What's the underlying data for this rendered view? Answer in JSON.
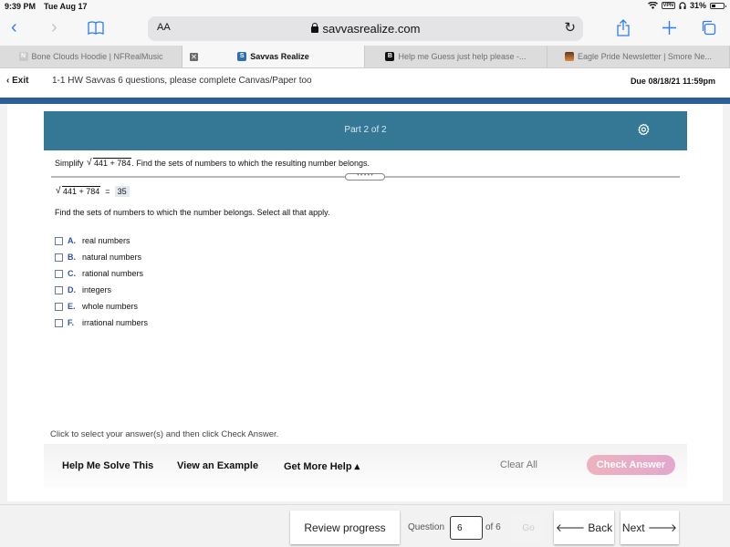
{
  "status_bar": {
    "time": "9:39 PM",
    "date": "Tue Aug 17",
    "vpn_label": "VPN",
    "battery_percent": "31%",
    "battery_level": 0.31
  },
  "browser": {
    "text_size_label": "AA",
    "url": "savvasrealize.com",
    "icons": [
      "back-icon",
      "forward-icon",
      "bookmarks-icon",
      "lock-icon",
      "reload-icon",
      "share-icon",
      "new-tab-icon",
      "tabs-icon"
    ]
  },
  "tabs": [
    {
      "title": "Bone Clouds Hoodie | NFRealMusic",
      "favicon": "N",
      "active": false
    },
    {
      "title": "Savvas Realize",
      "favicon": "S",
      "active": true
    },
    {
      "title": "Help me Guess just help please -...",
      "favicon": "B",
      "active": false
    },
    {
      "title": "Eagle Pride Newsletter | Smore Ne...",
      "favicon": "",
      "active": false
    }
  ],
  "assignment": {
    "exit_label": "Exit",
    "title": "1-1 HW Savvas 6 questions, please complete Canvas/Paper too",
    "due": "Due 08/18/21 11:59pm"
  },
  "question": {
    "part_label": "Part 2 of 2",
    "prompt_prefix": "Simplify",
    "radicand": "441 + 784",
    "prompt_suffix": ". Find the sets of numbers to which the resulting number belongs.",
    "grip_dots": "• • • • •",
    "answer_radicand": "441 + 784",
    "equals": "=",
    "answer_value": "35",
    "instruction": "Find the sets of numbers to which the number belongs. Select all that apply.",
    "options": [
      {
        "letter": "A.",
        "text": "real numbers",
        "checked": false
      },
      {
        "letter": "B.",
        "text": "natural numbers",
        "checked": false
      },
      {
        "letter": "C.",
        "text": "rational numbers",
        "checked": false
      },
      {
        "letter": "D.",
        "text": "integers",
        "checked": false
      },
      {
        "letter": "E.",
        "text": "whole numbers",
        "checked": false
      },
      {
        "letter": "F.",
        "text": "irrational numbers",
        "checked": false
      }
    ]
  },
  "help": {
    "hint": "Click to select your answer(s) and then click Check Answer.",
    "help_me_solve": "Help Me Solve This",
    "view_example": "View an Example",
    "get_more_help": "Get More Help ▴",
    "clear_all": "Clear All",
    "check_answer": "Check Answer"
  },
  "footer": {
    "review_progress": "Review progress",
    "question_label": "Question",
    "question_number": "6",
    "of_label": "of 6",
    "go_label": "Go",
    "back_label": "🡐 Back",
    "next_label": "Next 🡒"
  },
  "colors": {
    "part_header": "#347896",
    "top_rule": "#2c5e98",
    "option_letter": "#2f52a6",
    "check_answer_start": "#ecb3bd",
    "check_answer_end": "#e4a7cf",
    "safari_blue": "#2d7cf6"
  }
}
